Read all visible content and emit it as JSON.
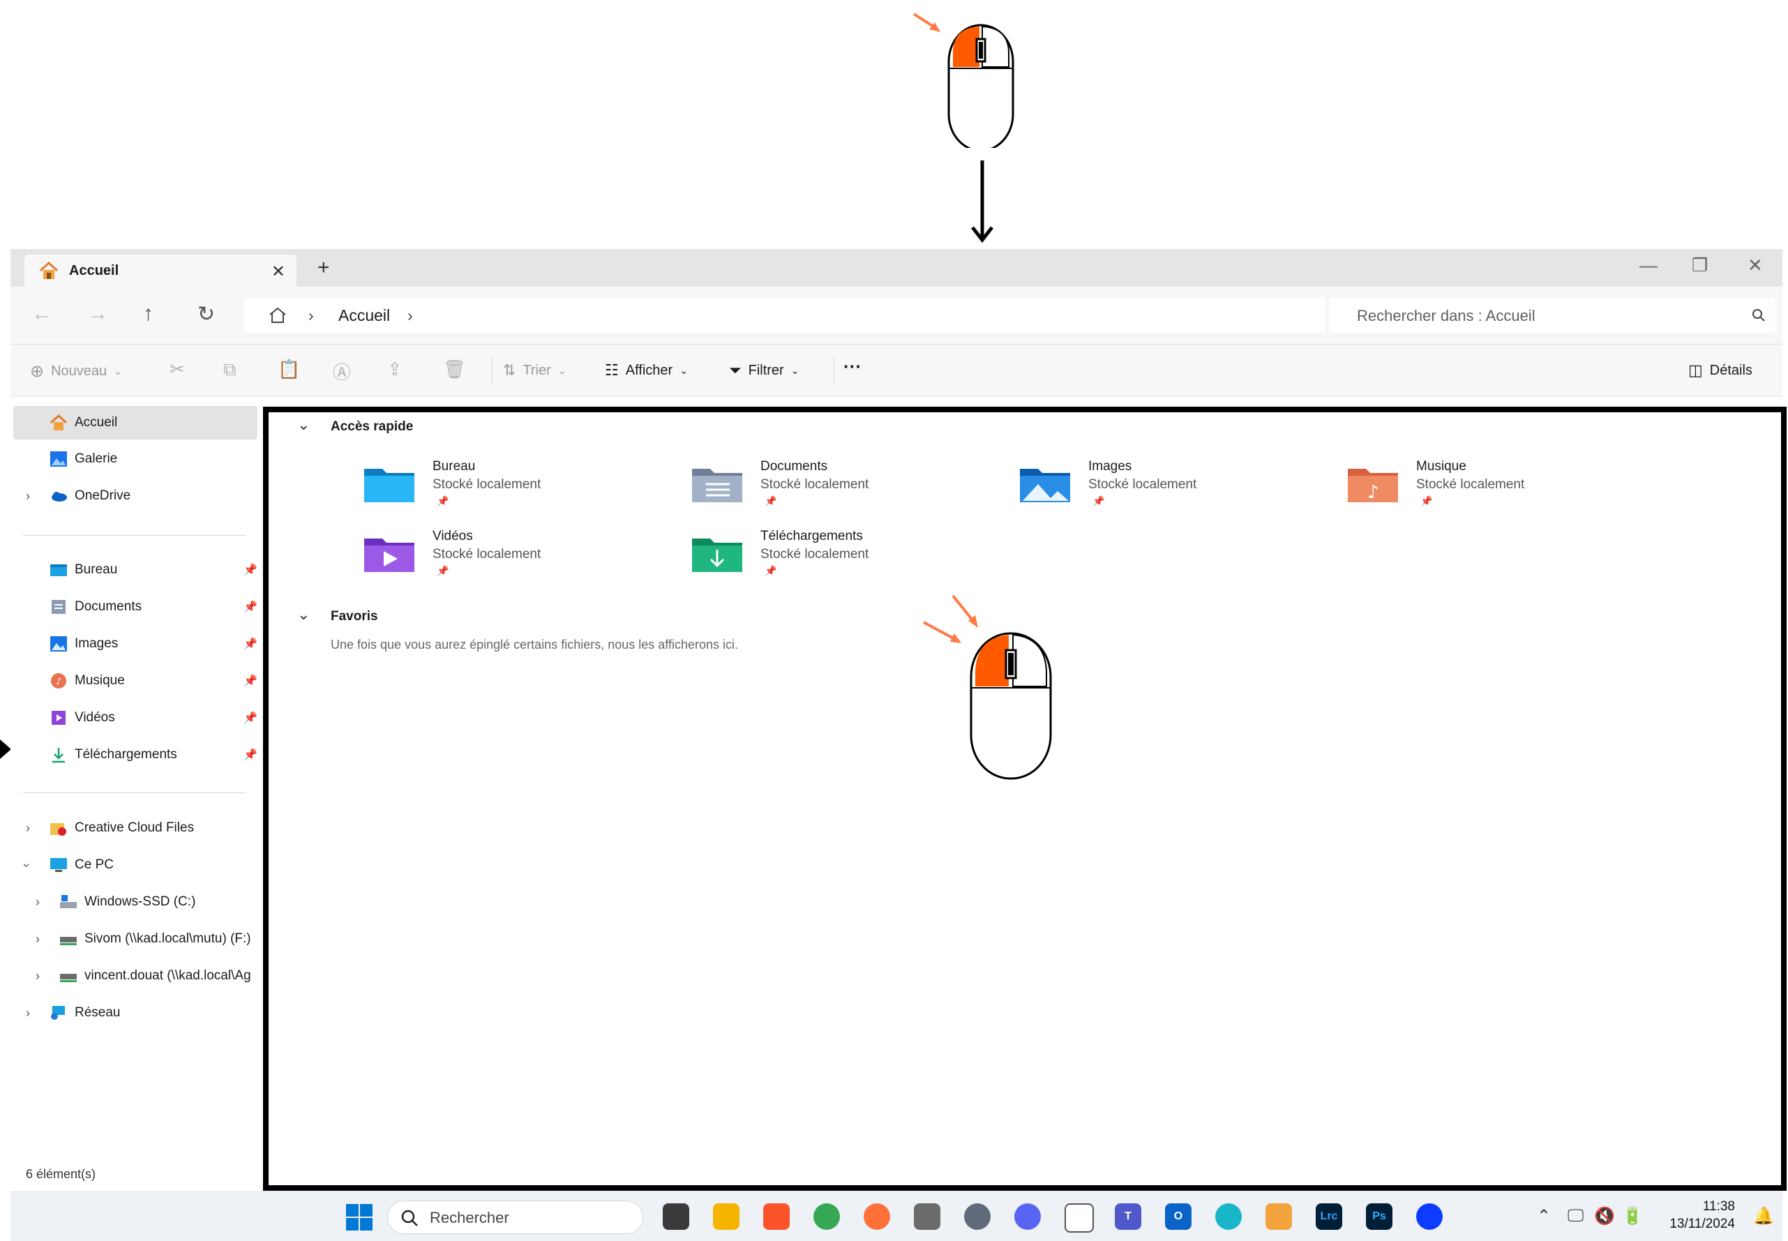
{
  "window": {
    "tab_title": "Accueil",
    "tab_close": "✕",
    "new_tab": "+",
    "minimize": "—",
    "restore": "❐",
    "close": "✕"
  },
  "nav": {
    "breadcrumb_sep": "›",
    "crumb": "Accueil",
    "search_placeholder": "Rechercher dans : Accueil"
  },
  "toolbar": {
    "new_label": "Nouveau",
    "sort_label": "Trier",
    "view_label": "Afficher",
    "filter_label": "Filtrer",
    "more_label": "···",
    "details_label": "Détails"
  },
  "sidebar": {
    "top": [
      {
        "label": "Accueil",
        "icon": "home-icon"
      },
      {
        "label": "Galerie",
        "icon": "gallery-icon"
      },
      {
        "label": "OneDrive",
        "icon": "cloud-icon"
      }
    ],
    "pinned": [
      {
        "label": "Bureau",
        "icon": "desktop-icon"
      },
      {
        "label": "Documents",
        "icon": "documents-icon"
      },
      {
        "label": "Images",
        "icon": "pictures-icon"
      },
      {
        "label": "Musique",
        "icon": "music-icon"
      },
      {
        "label": "Vidéos",
        "icon": "videos-icon"
      },
      {
        "label": "Téléchargements",
        "icon": "downloads-icon"
      }
    ],
    "tree": [
      {
        "label": "Creative Cloud Files",
        "icon": "creative-cloud-folder-icon"
      },
      {
        "label": "Ce PC",
        "icon": "pc-icon"
      },
      {
        "label": "Windows-SSD (C:)",
        "icon": "drive-icon"
      },
      {
        "label": "Sivom (\\\\kad.local\\mutu) (F:)",
        "icon": "network-drive-icon"
      },
      {
        "label": "vincent.douat (\\\\kad.local\\Ag",
        "icon": "network-drive-icon"
      },
      {
        "label": "Réseau",
        "icon": "network-icon"
      }
    ],
    "status": "6 élément(s)"
  },
  "main": {
    "quick_access_title": "Accès rapide",
    "favorites_title": "Favoris",
    "favorites_message": "Une fois que vous aurez épinglé certains fichiers, nous les afficherons ici.",
    "subtitle": "Stocké localement",
    "folders": [
      {
        "name": "Bureau",
        "icon": "desktop-folder-icon"
      },
      {
        "name": "Documents",
        "icon": "documents-folder-icon"
      },
      {
        "name": "Images",
        "icon": "pictures-folder-icon"
      },
      {
        "name": "Musique",
        "icon": "music-folder-icon"
      },
      {
        "name": "Vidéos",
        "icon": "videos-folder-icon"
      },
      {
        "name": "Téléchargements",
        "icon": "downloads-folder-icon"
      }
    ]
  },
  "taskbar": {
    "search_placeholder": "Rechercher",
    "lrc": "Lrc",
    "ps": "Ps",
    "time": "11:38",
    "date": "13/11/2024"
  },
  "colors": {
    "accent": "#0067c0",
    "mouse_button": "#ff5a00",
    "arrow": "#ff7a45"
  }
}
